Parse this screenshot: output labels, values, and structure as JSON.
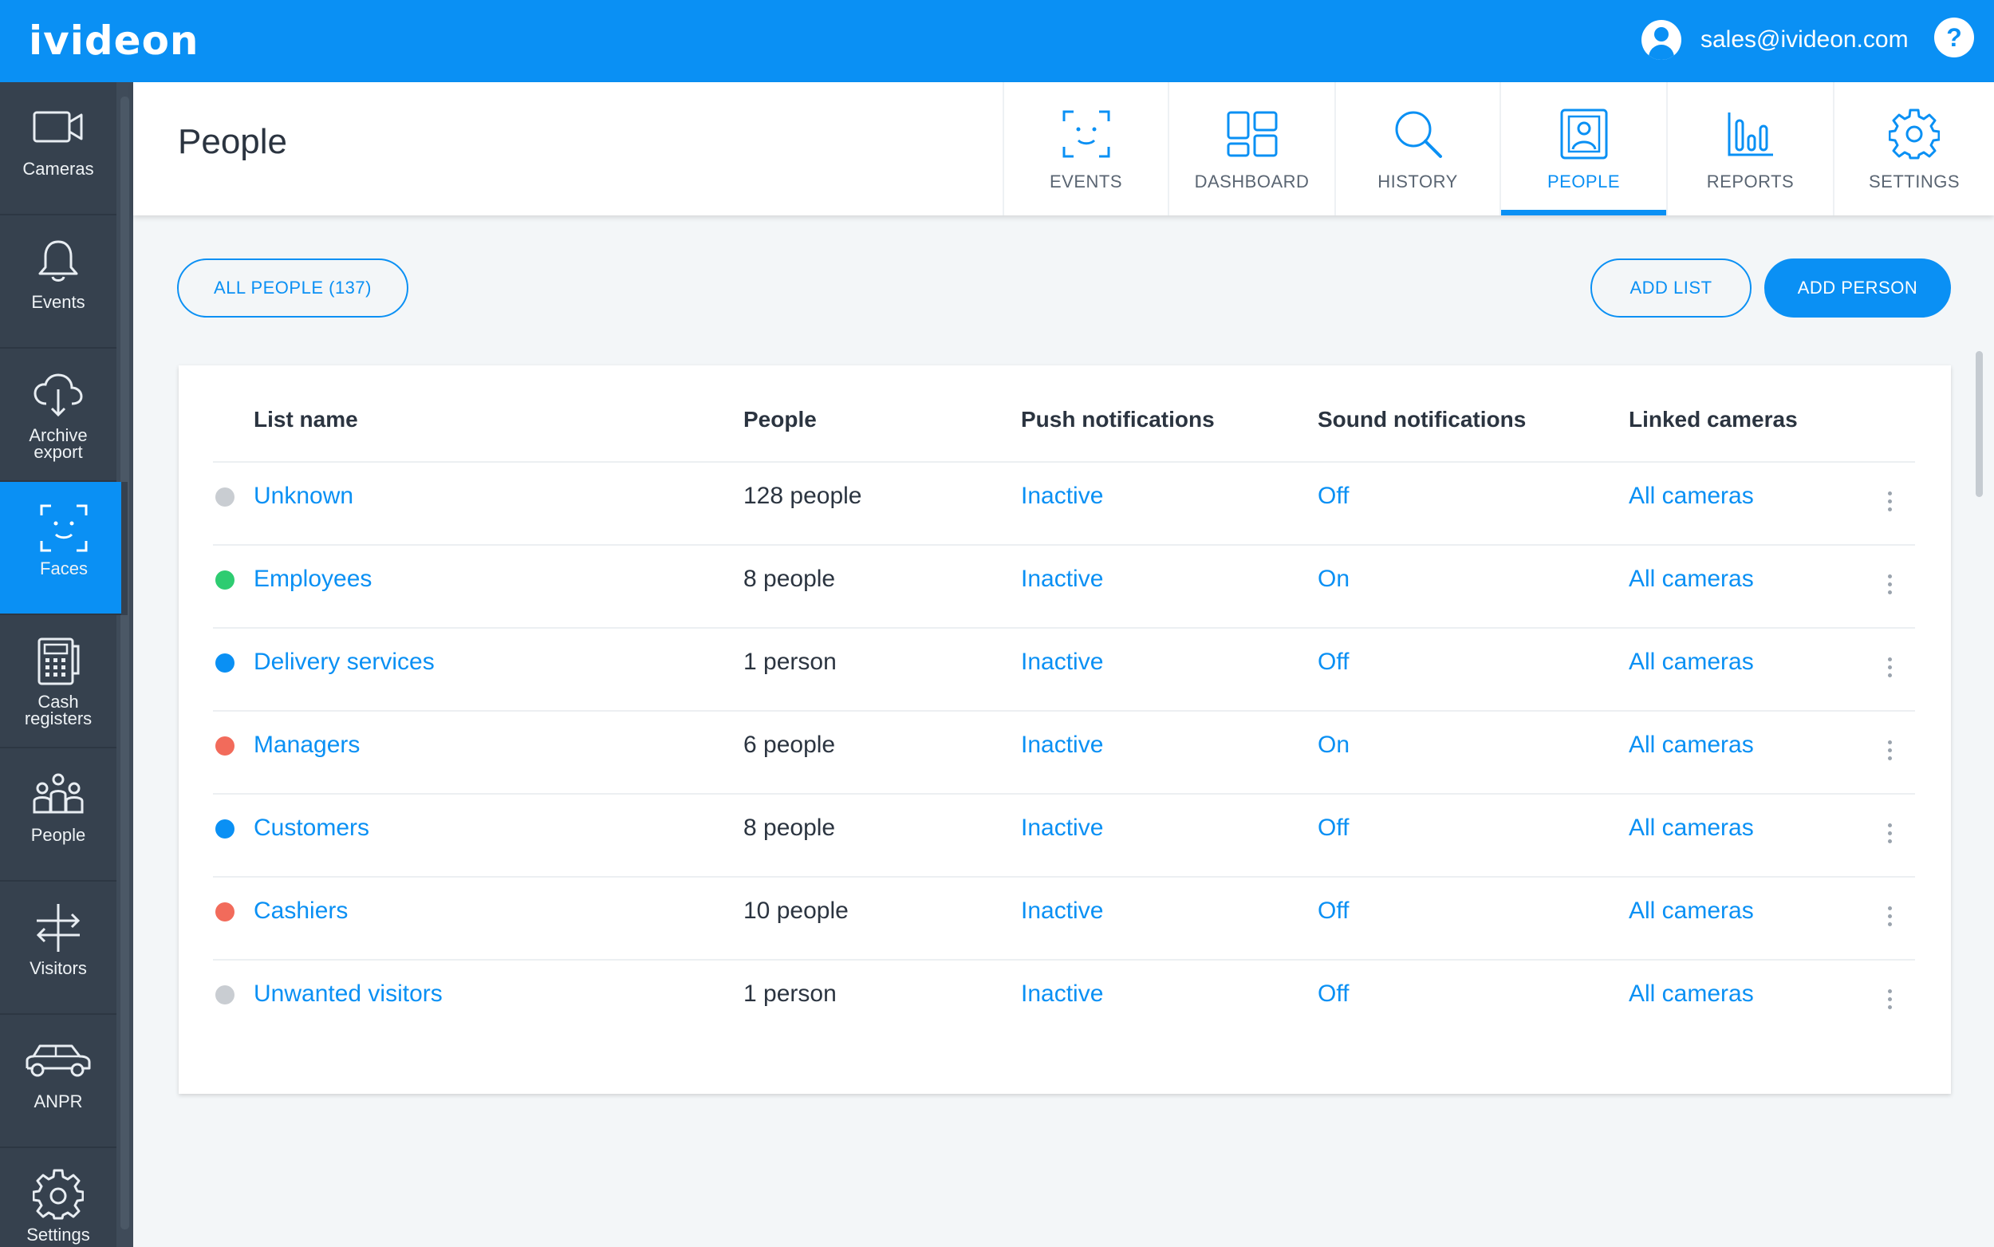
{
  "app": {
    "logo": "ivideon"
  },
  "account": {
    "email": "sales@ivideon.com",
    "help_label": "?"
  },
  "sidebar": {
    "items": [
      {
        "label": "Cameras",
        "icon": "camera-icon"
      },
      {
        "label": "Events",
        "icon": "bell-icon"
      },
      {
        "label": "Archive export",
        "icon": "cloud-download-icon"
      },
      {
        "label": "Faces",
        "icon": "face-icon",
        "active": true
      },
      {
        "label": "Cash registers",
        "icon": "cash-register-icon"
      },
      {
        "label": "People",
        "icon": "people-icon"
      },
      {
        "label": "Visitors",
        "icon": "visitors-icon"
      },
      {
        "label": "ANPR",
        "icon": "car-icon"
      },
      {
        "label": "Settings",
        "icon": "gear-icon"
      }
    ]
  },
  "header": {
    "title": "People",
    "tabs": [
      {
        "label": "EVENTS",
        "icon": "face-scan-icon"
      },
      {
        "label": "DASHBOARD",
        "icon": "dashboard-icon"
      },
      {
        "label": "HISTORY",
        "icon": "search-icon"
      },
      {
        "label": "PEOPLE",
        "icon": "person-card-icon",
        "active": true
      },
      {
        "label": "REPORTS",
        "icon": "bar-chart-icon"
      },
      {
        "label": "SETTINGS",
        "icon": "gear-icon"
      }
    ]
  },
  "actions": {
    "all_people": "ALL PEOPLE (137)",
    "add_list": "ADD LIST",
    "add_person": "ADD PERSON"
  },
  "table": {
    "columns": {
      "list_name": "List name",
      "people": "People",
      "push": "Push notifications",
      "sound": "Sound notifications",
      "cameras": "Linked cameras"
    },
    "rows": [
      {
        "color": "#c9cdd2",
        "name": "Unknown",
        "people": "128 people",
        "push": "Inactive",
        "sound": "Off",
        "cameras": "All cameras"
      },
      {
        "color": "#2ecc71",
        "name": "Employees",
        "people": "8 people",
        "push": "Inactive",
        "sound": "On",
        "cameras": "All cameras"
      },
      {
        "color": "#0a90f4",
        "name": "Delivery services",
        "people": "1 person",
        "push": "Inactive",
        "sound": "Off",
        "cameras": "All cameras"
      },
      {
        "color": "#f26b5b",
        "name": "Managers",
        "people": "6 people",
        "push": "Inactive",
        "sound": "On",
        "cameras": "All cameras"
      },
      {
        "color": "#0a90f4",
        "name": "Customers",
        "people": "8 people",
        "push": "Inactive",
        "sound": "Off",
        "cameras": "All cameras"
      },
      {
        "color": "#f26b5b",
        "name": "Cashiers",
        "people": "10 people",
        "push": "Inactive",
        "sound": "Off",
        "cameras": "All cameras"
      },
      {
        "color": "#c9cdd2",
        "name": "Unwanted visitors",
        "people": "1 person",
        "push": "Inactive",
        "sound": "Off",
        "cameras": "All cameras"
      }
    ]
  },
  "colors": {
    "accent": "#0a90f4",
    "sidebar": "#36414e",
    "background": "#f3f6f8"
  }
}
